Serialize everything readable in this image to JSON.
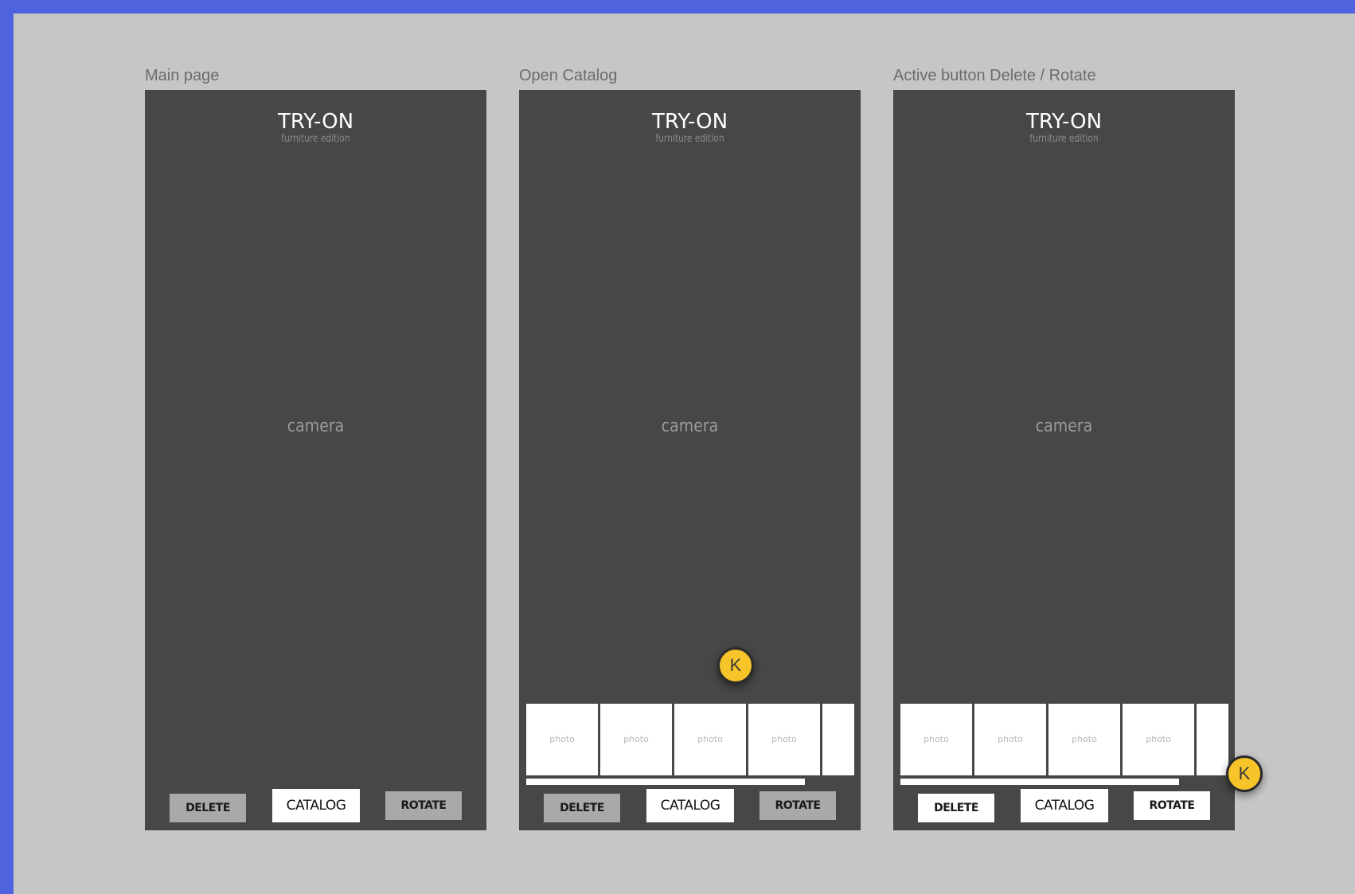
{
  "frames": [
    {
      "label": "Main page",
      "title": "TRY-ON",
      "subtitle": "furniture edition",
      "camera_label": "camera",
      "buttons": {
        "delete": "DELETE",
        "catalog": "CATALOG",
        "rotate": "ROTATE"
      },
      "delete_rotate_state": "inactive",
      "catalog_open": false
    },
    {
      "label": "Open Catalog",
      "title": "TRY-ON",
      "subtitle": "furniture edition",
      "camera_label": "camera",
      "buttons": {
        "delete": "DELETE",
        "catalog": "CATALOG",
        "rotate": "ROTATE"
      },
      "delete_rotate_state": "inactive",
      "catalog_open": true,
      "photos": [
        "photo",
        "photo",
        "photo",
        "photo",
        ""
      ],
      "cursor_initial": "K"
    },
    {
      "label": "Active button Delete / Rotate",
      "title": "TRY-ON",
      "subtitle": "furniture edition",
      "camera_label": "camera",
      "buttons": {
        "delete": "DELETE",
        "catalog": "CATALOG",
        "rotate": "ROTATE"
      },
      "delete_rotate_state": "active",
      "catalog_open": true,
      "photos": [
        "photo",
        "photo",
        "photo",
        "photo",
        ""
      ],
      "cursor_initial": "K"
    }
  ],
  "colors": {
    "outer_background": "#4f63de",
    "canvas_background": "#c6c6c6",
    "phone_background": "#474747",
    "button_inactive": "#a9a9a9",
    "button_active": "#ffffff",
    "cursor_avatar": "#f7c52a"
  }
}
